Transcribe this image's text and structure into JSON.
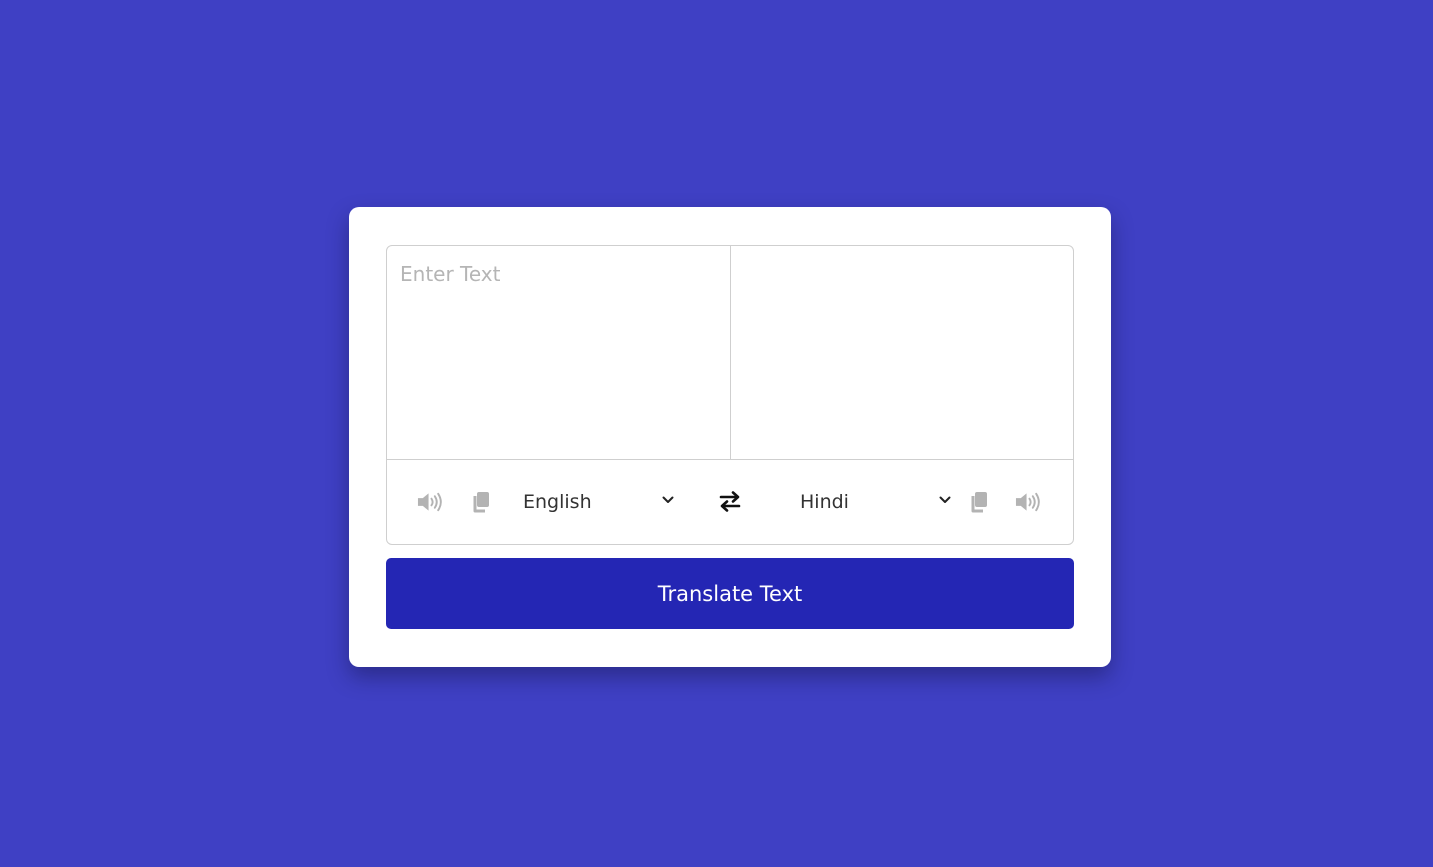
{
  "from": {
    "placeholder": "Enter Text",
    "value": "",
    "language": "English"
  },
  "to": {
    "placeholder": "",
    "value": "",
    "language": "Hindi"
  },
  "icons": {
    "speak": "volume-icon",
    "copy": "copy-icon",
    "dropdown": "chevron-down-icon",
    "swap": "exchange-icon"
  },
  "translate_button": {
    "label": "Translate Text"
  },
  "colors": {
    "background": "#3f40c4",
    "card": "#ffffff",
    "button": "#2426b4",
    "icon_muted": "#b3b3b3"
  }
}
